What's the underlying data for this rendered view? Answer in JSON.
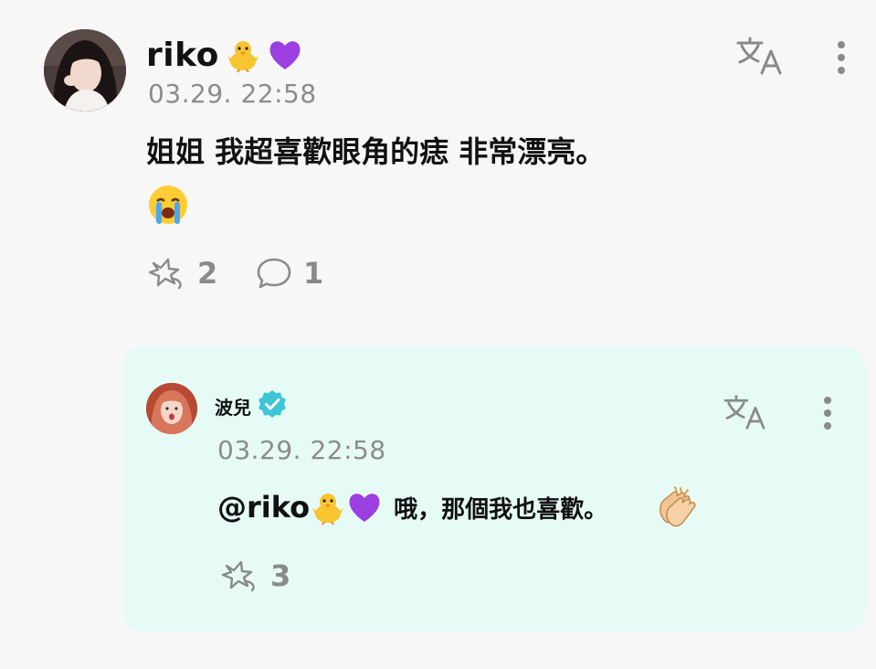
{
  "comment": {
    "author": "riko",
    "author_emojis": [
      "baby-chick-emoji",
      "purple-heart-emoji"
    ],
    "timestamp": "03.29. 22:58",
    "text": "姐姐 我超喜歡眼角的痣 非常漂亮。",
    "text_emoji": "loudly-crying-face-emoji",
    "like_count": "2",
    "reply_count": "1",
    "icons": {
      "translate": "translate-icon",
      "more": "more-vertical-icon",
      "like": "like-icon",
      "reply": "comment-bubble-icon"
    }
  },
  "reply": {
    "author": "波兒",
    "verified": true,
    "timestamp": "03.29. 22:58",
    "mention": "@riko",
    "mention_emojis": [
      "baby-chick-emoji",
      "purple-heart-emoji"
    ],
    "text": "哦，那個我也喜歡。",
    "text_emoji": "clapping-hands-emoji",
    "like_count": "3",
    "background_color": "#e6fbf6",
    "verified_color": "#3ec6d7",
    "icons": {
      "translate": "translate-icon",
      "more": "more-vertical-icon",
      "like": "like-icon"
    }
  },
  "colors": {
    "background": "#f7f7f7",
    "muted_text": "#8c8c8c",
    "primary_text": "#111111"
  }
}
